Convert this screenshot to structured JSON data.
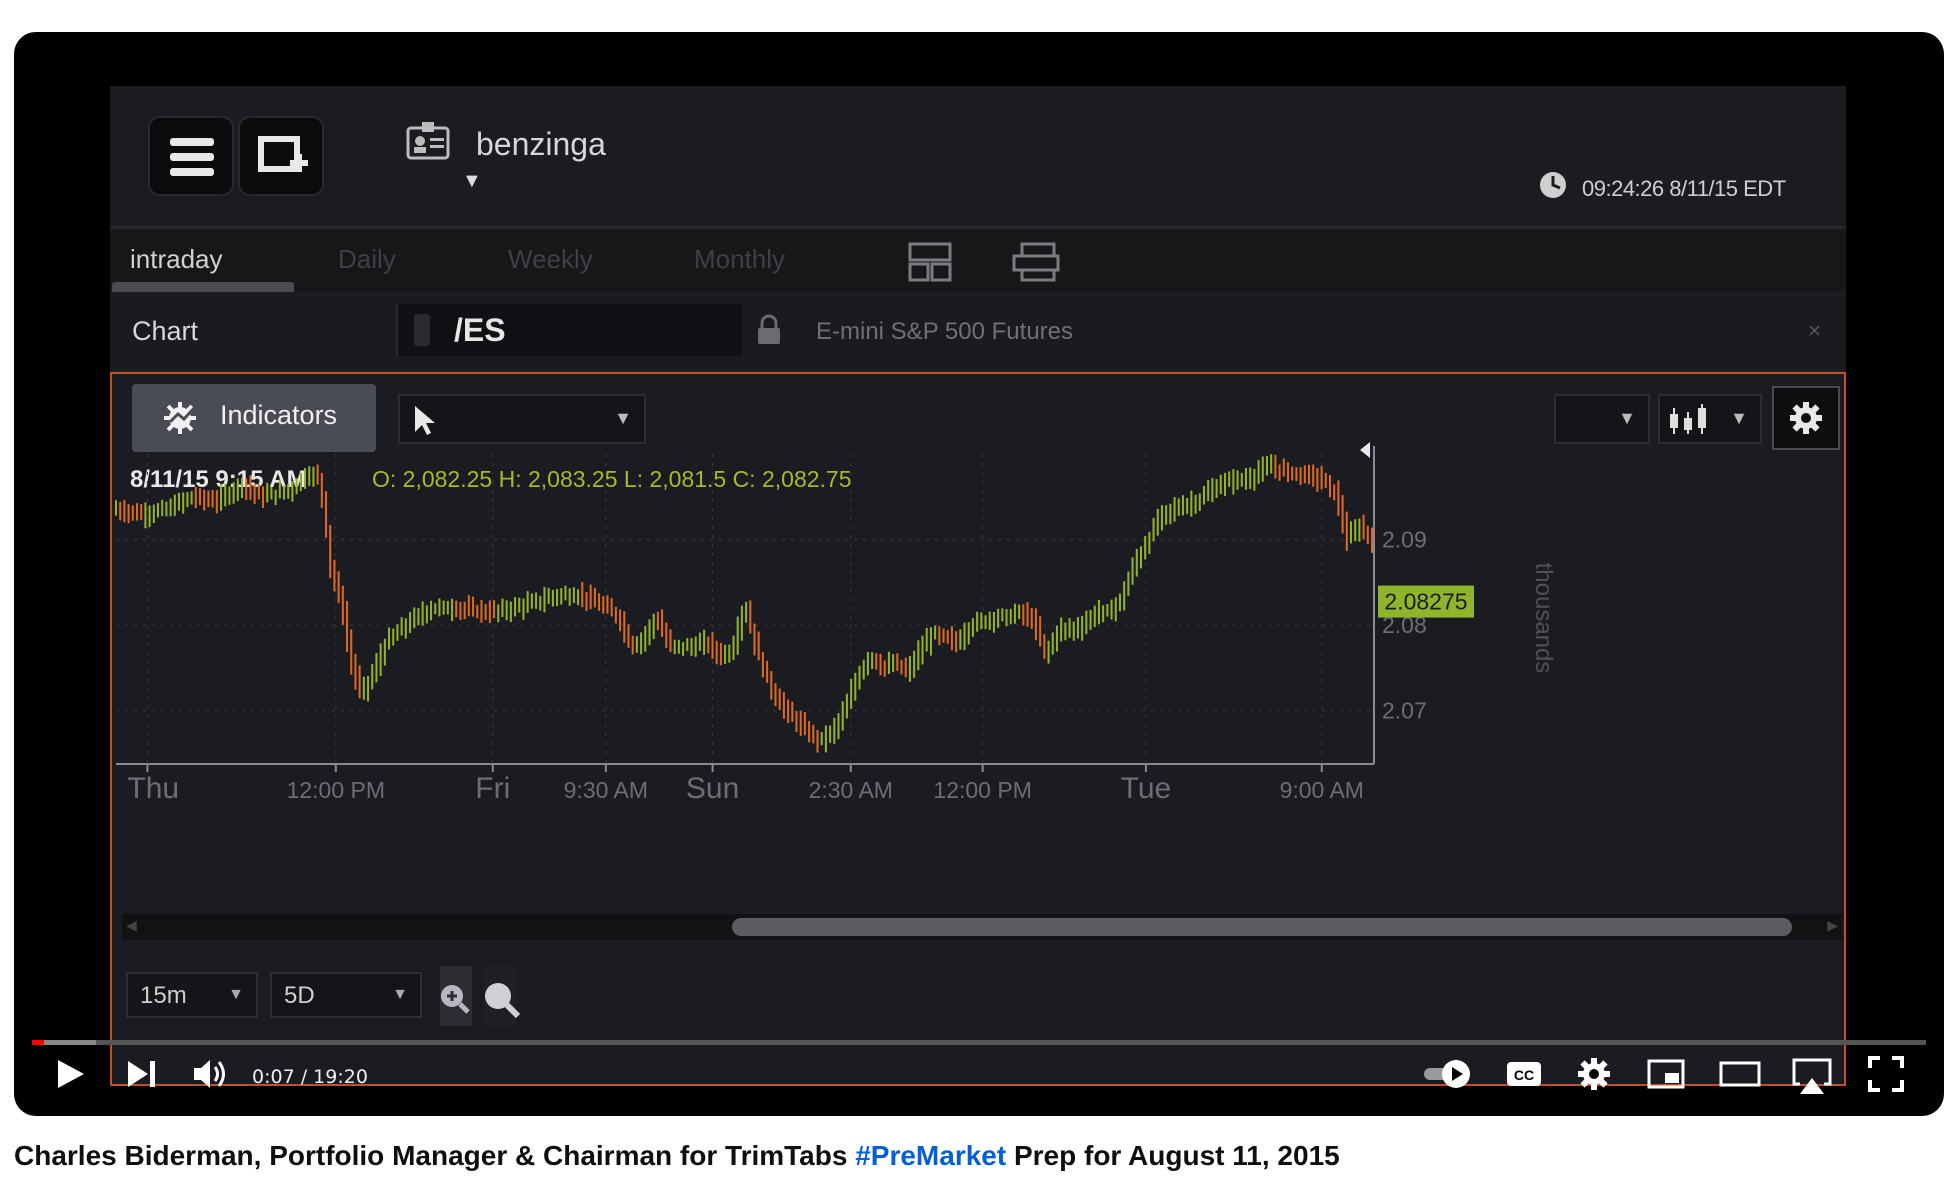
{
  "app": {
    "account_name": "benzinga",
    "clock_text": "09:24:26 8/11/15 EDT",
    "tabs": [
      "intraday",
      "Daily",
      "Weekly",
      "Monthly"
    ],
    "chart_label": "Chart",
    "symbol": "/ES",
    "symbol_description": "E-mini S&P 500 Futures",
    "close_label": "×",
    "indicators_label": "Indicators",
    "ohlc_date": "8/11/15  9:15 AM",
    "ohlc_values": "O: 2,082.25 H: 2,083.25 L: 2,081.5 C: 2,082.75",
    "interval": "15m",
    "range": "5D"
  },
  "chart_data": {
    "type": "bar",
    "x_tick_labels": [
      "Thu",
      "12:00 PM",
      "Fri",
      "9:30 AM",
      "Sun",
      "2:30 AM",
      "12:00 PM",
      "Tue",
      "9:00 AM"
    ],
    "y_tick_labels": [
      "2.09",
      "2.08",
      "2.07"
    ],
    "y_axis_label": "thousands",
    "ylim": [
      2.064,
      2.1
    ],
    "last_price_label": "2.08275",
    "price_path": [
      [
        0,
        2.0935
      ],
      [
        0.02,
        2.093
      ],
      [
        0.04,
        2.0935
      ],
      [
        0.06,
        2.095
      ],
      [
        0.08,
        2.0945
      ],
      [
        0.1,
        2.0965
      ],
      [
        0.115,
        2.095
      ],
      [
        0.13,
        2.0955
      ],
      [
        0.14,
        2.096
      ],
      [
        0.15,
        2.0975
      ],
      [
        0.16,
        2.0975
      ],
      [
        0.165,
        2.0945
      ],
      [
        0.17,
        2.087
      ],
      [
        0.18,
        2.082
      ],
      [
        0.185,
        2.077
      ],
      [
        0.19,
        2.074
      ],
      [
        0.195,
        2.072
      ],
      [
        0.205,
        2.0745
      ],
      [
        0.215,
        2.078
      ],
      [
        0.23,
        2.08
      ],
      [
        0.25,
        2.082
      ],
      [
        0.27,
        2.082
      ],
      [
        0.3,
        2.0815
      ],
      [
        0.33,
        2.0825
      ],
      [
        0.35,
        2.0835
      ],
      [
        0.37,
        2.0835
      ],
      [
        0.39,
        2.082
      ],
      [
        0.4,
        2.081
      ],
      [
        0.41,
        2.0775
      ],
      [
        0.42,
        2.0785
      ],
      [
        0.43,
        2.081
      ],
      [
        0.44,
        2.0775
      ],
      [
        0.46,
        2.0775
      ],
      [
        0.47,
        2.078
      ],
      [
        0.48,
        2.0765
      ],
      [
        0.49,
        2.077
      ],
      [
        0.5,
        2.0825
      ],
      [
        0.51,
        2.077
      ],
      [
        0.52,
        2.073
      ],
      [
        0.53,
        2.0705
      ],
      [
        0.54,
        2.069
      ],
      [
        0.55,
        2.0675
      ],
      [
        0.56,
        2.0665
      ],
      [
        0.57,
        2.0675
      ],
      [
        0.58,
        2.07
      ],
      [
        0.59,
        2.074
      ],
      [
        0.6,
        2.0765
      ],
      [
        0.61,
        2.075
      ],
      [
        0.62,
        2.0755
      ],
      [
        0.63,
        2.0745
      ],
      [
        0.64,
        2.077
      ],
      [
        0.65,
        2.079
      ],
      [
        0.66,
        2.0785
      ],
      [
        0.67,
        2.078
      ],
      [
        0.68,
        2.08
      ],
      [
        0.7,
        2.081
      ],
      [
        0.71,
        2.081
      ],
      [
        0.72,
        2.0815
      ],
      [
        0.73,
        2.0805
      ],
      [
        0.74,
        2.0765
      ],
      [
        0.75,
        2.0795
      ],
      [
        0.76,
        2.0795
      ],
      [
        0.77,
        2.08
      ],
      [
        0.78,
        2.0815
      ],
      [
        0.79,
        2.0815
      ],
      [
        0.8,
        2.083
      ],
      [
        0.81,
        2.087
      ],
      [
        0.82,
        2.0895
      ],
      [
        0.83,
        2.0925
      ],
      [
        0.84,
        2.0935
      ],
      [
        0.86,
        2.0945
      ],
      [
        0.87,
        2.0955
      ],
      [
        0.88,
        2.0965
      ],
      [
        0.89,
        2.097
      ],
      [
        0.9,
        2.097
      ],
      [
        0.91,
        2.098
      ],
      [
        0.92,
        2.0985
      ],
      [
        0.93,
        2.098
      ],
      [
        0.95,
        2.0975
      ],
      [
        0.96,
        2.097
      ],
      [
        0.97,
        2.0955
      ],
      [
        0.975,
        2.093
      ],
      [
        0.98,
        2.09
      ],
      [
        0.99,
        2.0915
      ],
      [
        1.0,
        2.09
      ]
    ]
  },
  "player": {
    "time": "0:07 / 19:20"
  },
  "video_title": {
    "prefix": "Charles Biderman, Portfolio Manager & Chairman for TrimTabs ",
    "hashtag": "#PreMarket",
    "suffix": " Prep for August 11, 2015"
  }
}
